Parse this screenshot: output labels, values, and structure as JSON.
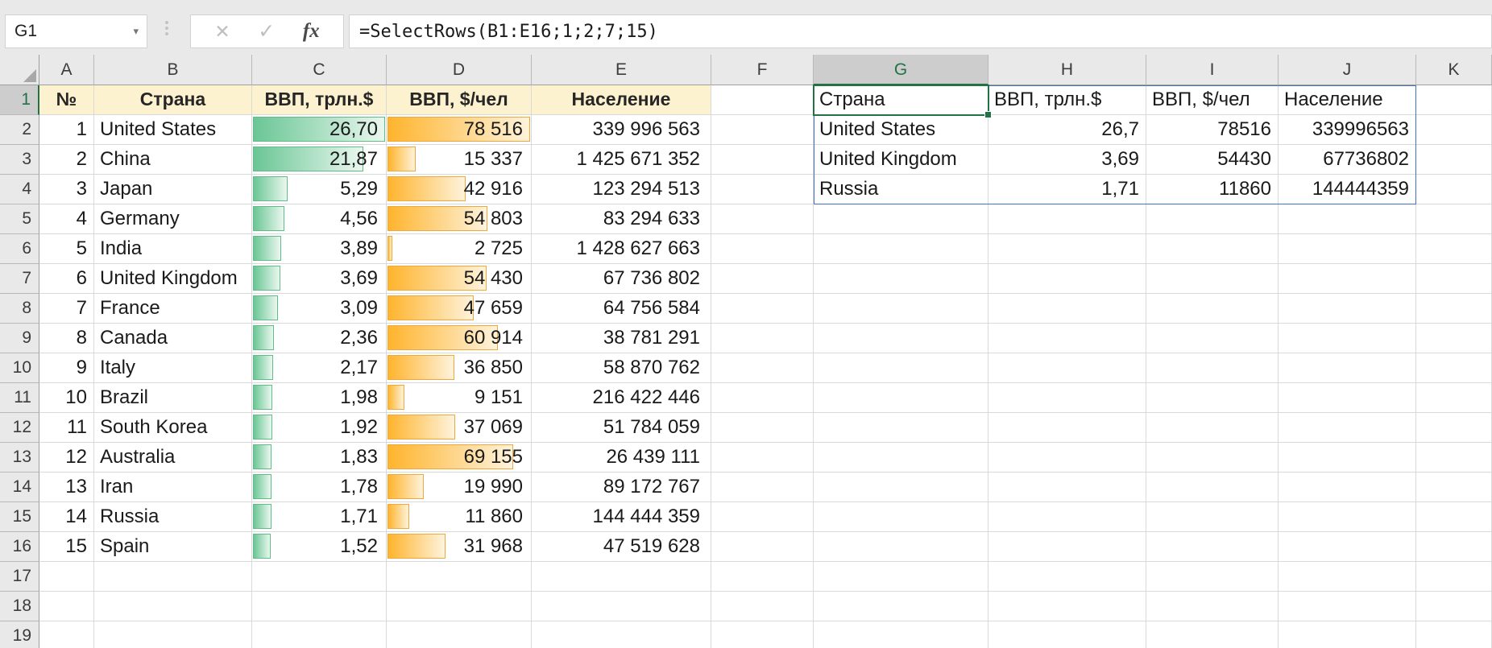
{
  "toolbar": {
    "name_box": "G1",
    "name_dropdown": "▾",
    "cancel_label": "✕",
    "enter_label": "✓",
    "fx_label": "fx",
    "formula": "=SelectRows(B1:E16;1;2;7;15)"
  },
  "sheet": {
    "column_letters": [
      "A",
      "B",
      "C",
      "D",
      "E",
      "F",
      "G",
      "H",
      "I",
      "J",
      "K"
    ],
    "selected_column": "G",
    "selected_row": 1,
    "visible_rows": 19,
    "left_table": {
      "headers": [
        "№",
        "Страна",
        "ВВП, трлн.$",
        "ВВП, $/чел",
        "Население"
      ],
      "gdp_max": 26.7,
      "percap_max": 78516,
      "rows": [
        {
          "num": "1",
          "country": "United States",
          "gdp": "26,70",
          "gdp_value": 26.7,
          "percap": "78 516",
          "percap_value": 78516,
          "population": "339 996 563"
        },
        {
          "num": "2",
          "country": "China",
          "gdp": "21,87",
          "gdp_value": 21.87,
          "percap": "15 337",
          "percap_value": 15337,
          "population": "1 425 671 352"
        },
        {
          "num": "3",
          "country": "Japan",
          "gdp": "5,29",
          "gdp_value": 5.29,
          "percap": "42 916",
          "percap_value": 42916,
          "population": "123 294 513"
        },
        {
          "num": "4",
          "country": "Germany",
          "gdp": "4,56",
          "gdp_value": 4.56,
          "percap": "54 803",
          "percap_value": 54803,
          "population": "83 294 633"
        },
        {
          "num": "5",
          "country": "India",
          "gdp": "3,89",
          "gdp_value": 3.89,
          "percap": "2 725",
          "percap_value": 2725,
          "population": "1 428 627 663"
        },
        {
          "num": "6",
          "country": "United Kingdom",
          "gdp": "3,69",
          "gdp_value": 3.69,
          "percap": "54 430",
          "percap_value": 54430,
          "population": "67 736 802"
        },
        {
          "num": "7",
          "country": "France",
          "gdp": "3,09",
          "gdp_value": 3.09,
          "percap": "47 659",
          "percap_value": 47659,
          "population": "64 756 584"
        },
        {
          "num": "8",
          "country": "Canada",
          "gdp": "2,36",
          "gdp_value": 2.36,
          "percap": "60 914",
          "percap_value": 60914,
          "population": "38 781 291"
        },
        {
          "num": "9",
          "country": "Italy",
          "gdp": "2,17",
          "gdp_value": 2.17,
          "percap": "36 850",
          "percap_value": 36850,
          "population": "58 870 762"
        },
        {
          "num": "10",
          "country": "Brazil",
          "gdp": "1,98",
          "gdp_value": 1.98,
          "percap": "9 151",
          "percap_value": 9151,
          "population": "216 422 446"
        },
        {
          "num": "11",
          "country": "South Korea",
          "gdp": "1,92",
          "gdp_value": 1.92,
          "percap": "37 069",
          "percap_value": 37069,
          "population": "51 784 059"
        },
        {
          "num": "12",
          "country": "Australia",
          "gdp": "1,83",
          "gdp_value": 1.83,
          "percap": "69 155",
          "percap_value": 69155,
          "population": "26 439 111"
        },
        {
          "num": "13",
          "country": "Iran",
          "gdp": "1,78",
          "gdp_value": 1.78,
          "percap": "19 990",
          "percap_value": 19990,
          "population": "89 172 767"
        },
        {
          "num": "14",
          "country": "Russia",
          "gdp": "1,71",
          "gdp_value": 1.71,
          "percap": "11 860",
          "percap_value": 11860,
          "population": "144 444 359"
        },
        {
          "num": "15",
          "country": "Spain",
          "gdp": "1,52",
          "gdp_value": 1.52,
          "percap": "31 968",
          "percap_value": 31968,
          "population": "47 519 628"
        }
      ]
    },
    "spill_table": {
      "anchor": "G1",
      "headers": [
        "Страна",
        "ВВП, трлн.$",
        "ВВП, $/чел",
        "Население"
      ],
      "rows": [
        {
          "country": "United States",
          "gdp": "26,7",
          "percap": "78516",
          "population": "339996563"
        },
        {
          "country": "United Kingdom",
          "gdp": "3,69",
          "percap": "54430",
          "population": "67736802"
        },
        {
          "country": "Russia",
          "gdp": "1,71",
          "percap": "11860",
          "population": "144444359"
        }
      ]
    }
  },
  "colors": {
    "excel_green": "#217346",
    "spill_border": "#4472C4",
    "header_fill": "#FDF2CF",
    "green_bar_start": "#6AC695",
    "green_bar_end": "#EAF7EF",
    "green_bar_border": "#5FBE86",
    "orange_bar_start": "#FFB42D",
    "orange_bar_end": "#FEF3DC",
    "orange_bar_border": "#F0A73C"
  }
}
